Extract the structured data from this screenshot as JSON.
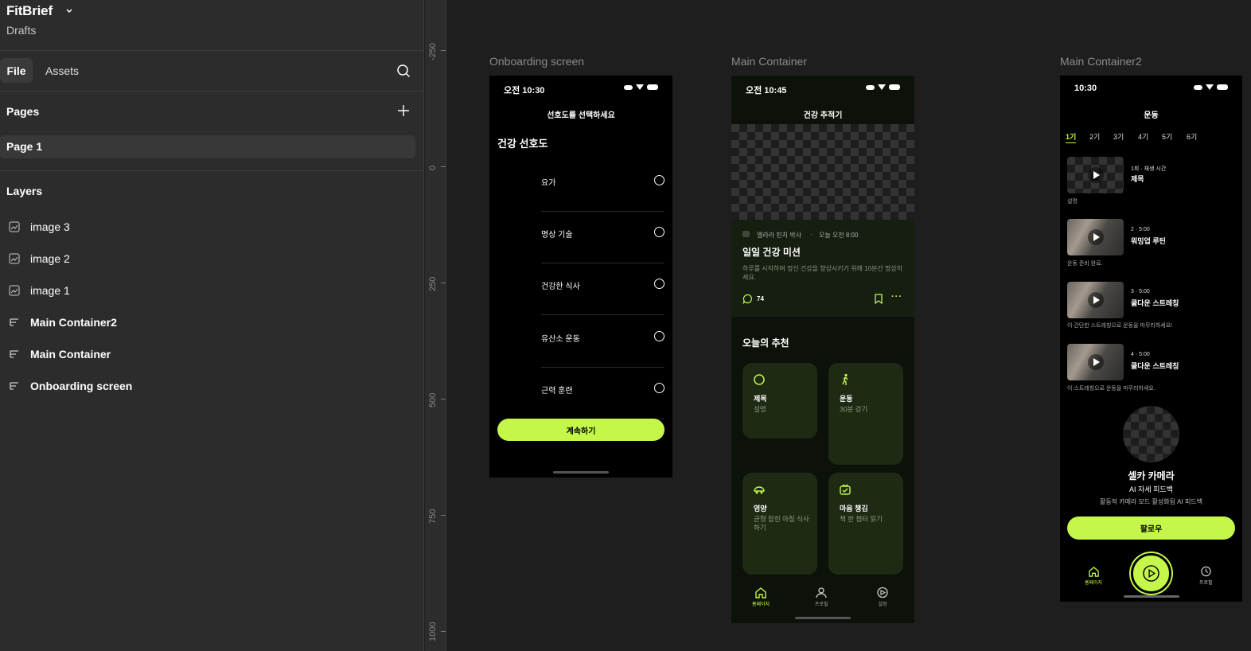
{
  "project": {
    "name": "FitBrief",
    "subtitle": "Drafts"
  },
  "tabs": {
    "file": "File",
    "assets": "Assets"
  },
  "pages": {
    "title": "Pages",
    "items": [
      "Page 1"
    ]
  },
  "layers": {
    "title": "Layers",
    "items": [
      "image 3",
      "image 2",
      "image 1",
      "Main Container2",
      "Main Container",
      "Onboarding screen"
    ]
  },
  "ruler": {
    "labels": [
      "-250",
      "0",
      "250",
      "500",
      "750",
      "1000"
    ]
  },
  "frames": {
    "onboarding": {
      "title": "Onboarding screen",
      "time": "오전 10:30",
      "header": "선호도를 선택하세요",
      "heading": "건강 선호도",
      "options": [
        "요가",
        "명상 기술",
        "건강한 식사",
        "유산소 운동",
        "근력 훈련"
      ],
      "button": "계속하기"
    },
    "main": {
      "title": "Main Container",
      "time": "오전 10:45",
      "header": "건강 추적기",
      "author": "엘라라 핀치 박사",
      "dot": "·",
      "post_time": "오늘 오전 8:00",
      "mission_title": "일일 건강 미션",
      "mission_desc": "하루를 시작하며 정신 건강을 향상시키기 위해 10분간 명상하세요.",
      "comments": "74",
      "section": "오늘의 추천",
      "cards": [
        {
          "title": "제목",
          "desc": "설명",
          "icon": "circle-icon"
        },
        {
          "title": "운동",
          "desc": "30분 걷기",
          "icon": "walking-icon"
        },
        {
          "title": "영양",
          "desc": "균형 잡힌 아침 식사하기",
          "icon": "food-icon"
        },
        {
          "title": "마음 챙김",
          "desc": "책 한 챕터 읽기",
          "icon": "book-check-icon"
        }
      ],
      "nav": [
        "홈페이지",
        "프로필",
        "설정"
      ]
    },
    "main2": {
      "title": "Main Container2",
      "time": "10:30",
      "header": "운동",
      "weeks": [
        "1기",
        "2기",
        "3기",
        "4기",
        "5기",
        "6기"
      ],
      "videos": [
        {
          "meta": "1회 · 재생 시간",
          "title": "제목",
          "desc": "설명"
        },
        {
          "meta": "2 · 5:00",
          "title": "워밍업 루틴",
          "desc": "운동 준비 완료."
        },
        {
          "meta": "3 · 5:00",
          "title": "쿨다운 스트레칭",
          "desc": "이 간단한 스트레칭으로 운동을 마무리하세요!"
        },
        {
          "meta": "4 · 5:00",
          "title": "쿨다운 스트레칭",
          "desc": "이 스트레칭으로 운동을 마무리하세요."
        }
      ],
      "selfie_title": "셀카 카메라",
      "selfie_sub": "AI 자세 피드백",
      "selfie_desc": "활동적 카메라 모드 활성화됨 AI 피드백",
      "follow_button": "팔로우",
      "nav": [
        "홈페이지",
        "프로필"
      ]
    }
  },
  "colors": {
    "accent": "#c4f74a",
    "card": "#1e2a14",
    "frame": "#000000"
  }
}
